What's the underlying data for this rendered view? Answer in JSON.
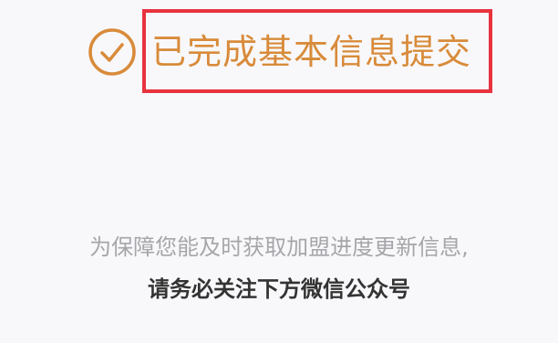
{
  "status": {
    "icon": "check-circle-icon",
    "title": "已完成基本信息提交",
    "accent_color": "#d88b3a",
    "highlight_color": "#e8333f"
  },
  "notice": {
    "line1": "为保障您能及时获取加盟进度更新信息,",
    "line2": "请务必关注下方微信公众号"
  }
}
